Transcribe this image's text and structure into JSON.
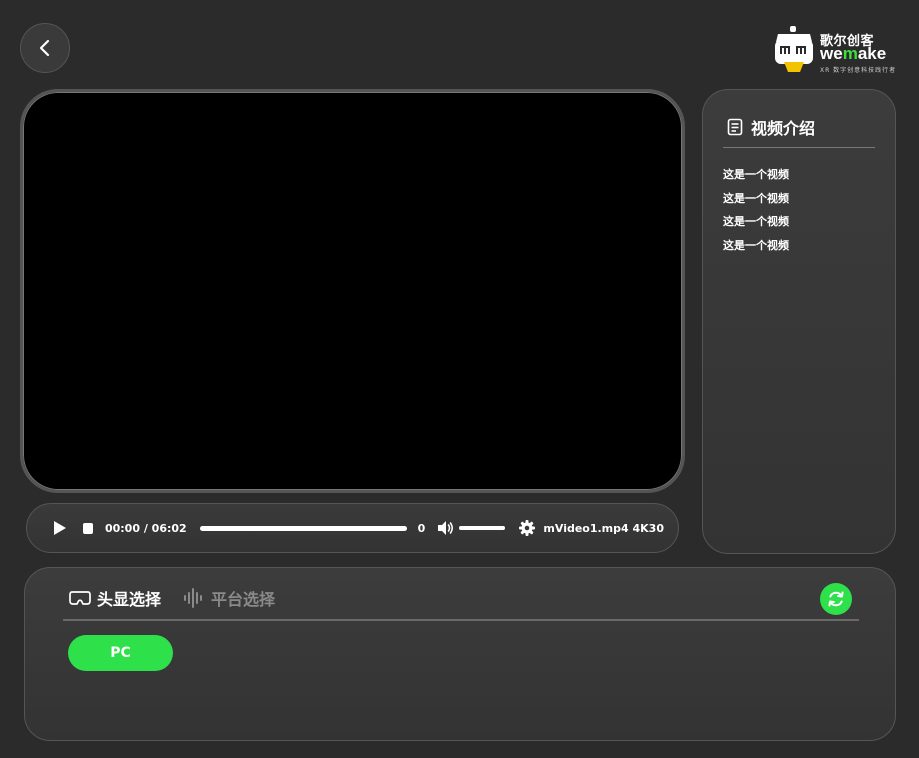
{
  "logo": {
    "name_cn": "歌尔创客",
    "name_en_prefix": "we",
    "name_en_dot": "m",
    "name_en_suffix": "ake",
    "tagline": "XR 数字创意科技践行者"
  },
  "player": {
    "time": "00:00 / 06:02",
    "progress": 1.0,
    "volume_value": "0",
    "volume_level": 1.0,
    "file_info": "mVideo1.mp4 4K30"
  },
  "intro": {
    "title": "视频介绍",
    "lines": [
      "这是一个视频",
      "这是一个视频",
      "这是一个视频",
      "这是一个视频"
    ]
  },
  "selector": {
    "tabs": [
      {
        "label": "头显选择",
        "icon": "vr-headset-icon",
        "active": true
      },
      {
        "label": "平台选择",
        "icon": "audio-wave-icon",
        "active": false
      }
    ],
    "options": [
      "PC"
    ]
  },
  "colors": {
    "accent": "#2ee04a",
    "background": "#2b2b2b"
  }
}
